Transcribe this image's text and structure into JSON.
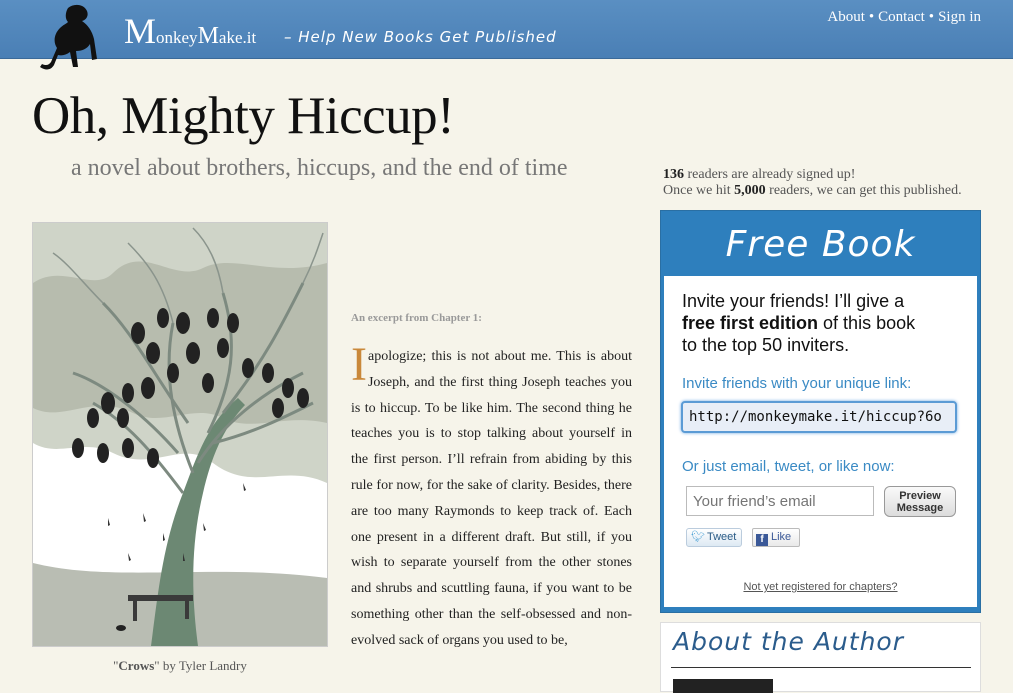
{
  "header": {
    "brand_cap_m": "M",
    "brand_onkey": "onkey",
    "brand_cap_m2": "M",
    "brand_ake": "ake.it",
    "tagline": "– Help New Books Get Published",
    "nav": [
      "About",
      "Contact",
      "Sign in"
    ],
    "nav_separator": "•"
  },
  "book": {
    "title": "Oh, Mighty Hiccup!",
    "subtitle": "a novel about brothers, hiccups, and the end of time"
  },
  "cover": {
    "caption_quote_open": "\"",
    "caption_title": "Crows",
    "caption_rest": "\" by Tyler Landry"
  },
  "excerpt": {
    "label": "An excerpt from Chapter 1:",
    "dropcap": "I",
    "text": " apologize; this is not about me. This is about Joseph, and the first thing Joseph teaches you is to hiccup. To be like him. The second thing he teaches you is to stop talking about yourself in the first person. I’ll refrain from abiding by this rule for now, for the sake of clarity. Besides, there are too many Raymonds to keep track of. Each one present in a different draft. But still, if you wish to separate yourself from the other stones and shrubs and scuttling fauna, if you want to be something other than the self-obsessed and non-evolved sack of organs you used to be,"
  },
  "signup": {
    "count": "136",
    "line1_rest": " readers are already signed up!",
    "line2_prefix": "Once we hit ",
    "goal": "5,000",
    "line2_rest": " readers, we can get this published."
  },
  "freebook": {
    "heading": "Free Book",
    "invite_pre": "Invite your friends! I’ll give a",
    "invite_bold": "free first edition",
    "invite_post": "of this book",
    "invite_line3": "to the top 50 inviters.",
    "link_label": "Invite friends with your unique link:",
    "link_value": "http://monkeymake.it/hiccup?6o",
    "or_label": "Or just email, tweet, or like now:",
    "email_placeholder": "Your friend’s email",
    "preview_line1": "Preview",
    "preview_line2": "Message",
    "tweet_label": "Tweet",
    "like_label": "Like",
    "not_registered": "Not yet registered for chapters?"
  },
  "about": {
    "title": "About the Author"
  },
  "colors": {
    "header_blue": "#4a7fb5",
    "freebook_blue": "#2e7fbd",
    "dropcap_orange": "#c9883a",
    "link_blue": "#3a8ac4"
  }
}
